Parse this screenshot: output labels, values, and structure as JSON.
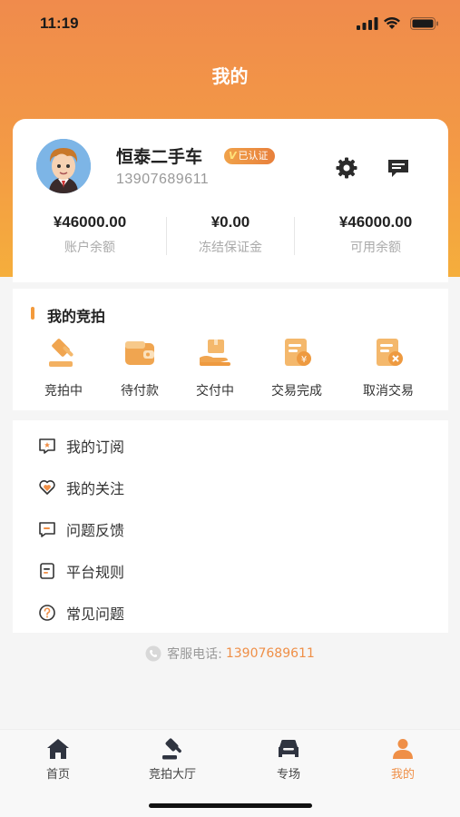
{
  "status_bar": {
    "time": "11:19"
  },
  "page": {
    "title": "我的"
  },
  "profile": {
    "name": "恒泰二手车",
    "verified_label": "已认证",
    "phone": "13907689611"
  },
  "balances": [
    {
      "amount": "¥46000.00",
      "label": "账户余额"
    },
    {
      "amount": "¥0.00",
      "label": "冻结保证金"
    },
    {
      "amount": "¥46000.00",
      "label": "可用余额"
    }
  ],
  "auction_section": {
    "title": "我的竞拍",
    "items": [
      {
        "label": "竞拍中",
        "icon": "gavel-icon"
      },
      {
        "label": "待付款",
        "icon": "wallet-icon"
      },
      {
        "label": "交付中",
        "icon": "delivery-icon"
      },
      {
        "label": "交易完成",
        "icon": "trade-done-icon"
      },
      {
        "label": "取消交易",
        "icon": "trade-cancel-icon"
      }
    ]
  },
  "menu": [
    {
      "label": "我的订阅",
      "icon": "subscribe-icon"
    },
    {
      "label": "我的关注",
      "icon": "heart-icon"
    },
    {
      "label": "问题反馈",
      "icon": "feedback-icon"
    },
    {
      "label": "平台规则",
      "icon": "rules-icon"
    },
    {
      "label": "常见问题",
      "icon": "question-icon"
    }
  ],
  "service": {
    "label": "客服电话:",
    "phone": "13907689611"
  },
  "tabs": [
    {
      "label": "首页",
      "icon": "home-icon"
    },
    {
      "label": "竞拍大厅",
      "icon": "gavel-icon"
    },
    {
      "label": "专场",
      "icon": "car-icon"
    },
    {
      "label": "我的",
      "icon": "person-icon",
      "active": true
    }
  ],
  "colors": {
    "accent": "#ef8f47",
    "header_top": "#f08b4c",
    "header_bottom": "#f5ae3c"
  }
}
